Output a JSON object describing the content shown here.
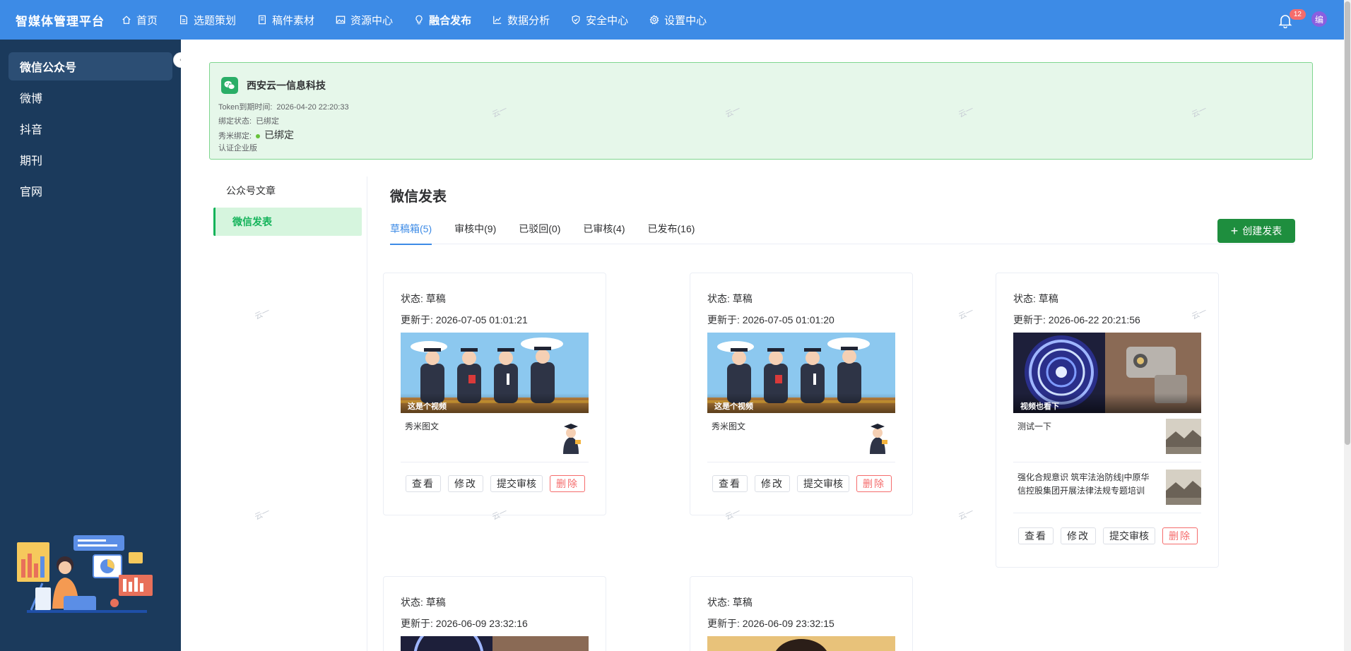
{
  "topnav": {
    "brand": "智媒体管理平台",
    "items": [
      {
        "label": "首页",
        "icon": "home-icon"
      },
      {
        "label": "选题策划",
        "icon": "document-icon"
      },
      {
        "label": "稿件素材",
        "icon": "file-icon"
      },
      {
        "label": "资源中心",
        "icon": "image-icon"
      },
      {
        "label": "融合发布",
        "icon": "lightbulb-icon",
        "active": true
      },
      {
        "label": "数据分析",
        "icon": "chart-icon"
      },
      {
        "label": "安全中心",
        "icon": "shield-icon"
      },
      {
        "label": "设置中心",
        "icon": "gear-icon"
      }
    ],
    "notification_count": "12",
    "avatar_text": "编"
  },
  "sidebar": {
    "items": [
      {
        "label": "微信公众号",
        "active": true
      },
      {
        "label": "微博"
      },
      {
        "label": "抖音"
      },
      {
        "label": "期刊"
      },
      {
        "label": "官网"
      }
    ]
  },
  "account": {
    "name": "西安云一信息科技",
    "token_label": "Token到期时间:",
    "token_value": "2026-04-20 22:20:33",
    "bind_label": "绑定状态:",
    "bind_value": "已绑定",
    "xiumi_label": "秀米绑定:",
    "xiumi_value": "已绑定",
    "verify": "认证企业版"
  },
  "submenu": {
    "items": [
      {
        "label": "公众号文章"
      },
      {
        "label": "微信发表",
        "active": true
      }
    ]
  },
  "main": {
    "title": "微信发表",
    "tabs": [
      {
        "label": "草稿箱(5)",
        "active": true
      },
      {
        "label": "审核中(9)"
      },
      {
        "label": "已驳回(0)"
      },
      {
        "label": "已审核(4)"
      },
      {
        "label": "已发布(16)"
      }
    ],
    "create_label": "创建发表"
  },
  "cards": [
    {
      "status": "状态: 草稿",
      "updated": "更新于: 2026-07-05 01:01:21",
      "cover_caption": "这是个视频",
      "articles": [
        {
          "title": "秀米图文"
        }
      ]
    },
    {
      "status": "状态: 草稿",
      "updated": "更新于: 2026-07-05 01:01:20",
      "cover_caption": "这是个视频",
      "articles": [
        {
          "title": "秀米图文"
        }
      ]
    },
    {
      "status": "状态: 草稿",
      "updated": "更新于: 2026-06-22 20:21:56",
      "cover_caption": "视频也看下",
      "articles": [
        {
          "title": "测试一下"
        },
        {
          "title": "强化合规意识 筑牢法治防线|中原华信控股集团开展法律法规专题培训"
        }
      ]
    },
    {
      "status": "状态: 草稿",
      "updated": "更新于: 2026-06-09 23:32:16"
    },
    {
      "status": "状态: 草稿",
      "updated": "更新于: 2026-06-09 23:32:15"
    }
  ],
  "card_actions": {
    "view": "查看",
    "edit": "修改",
    "submit": "提交审核",
    "delete": "删除"
  },
  "watermark_text": "云一"
}
